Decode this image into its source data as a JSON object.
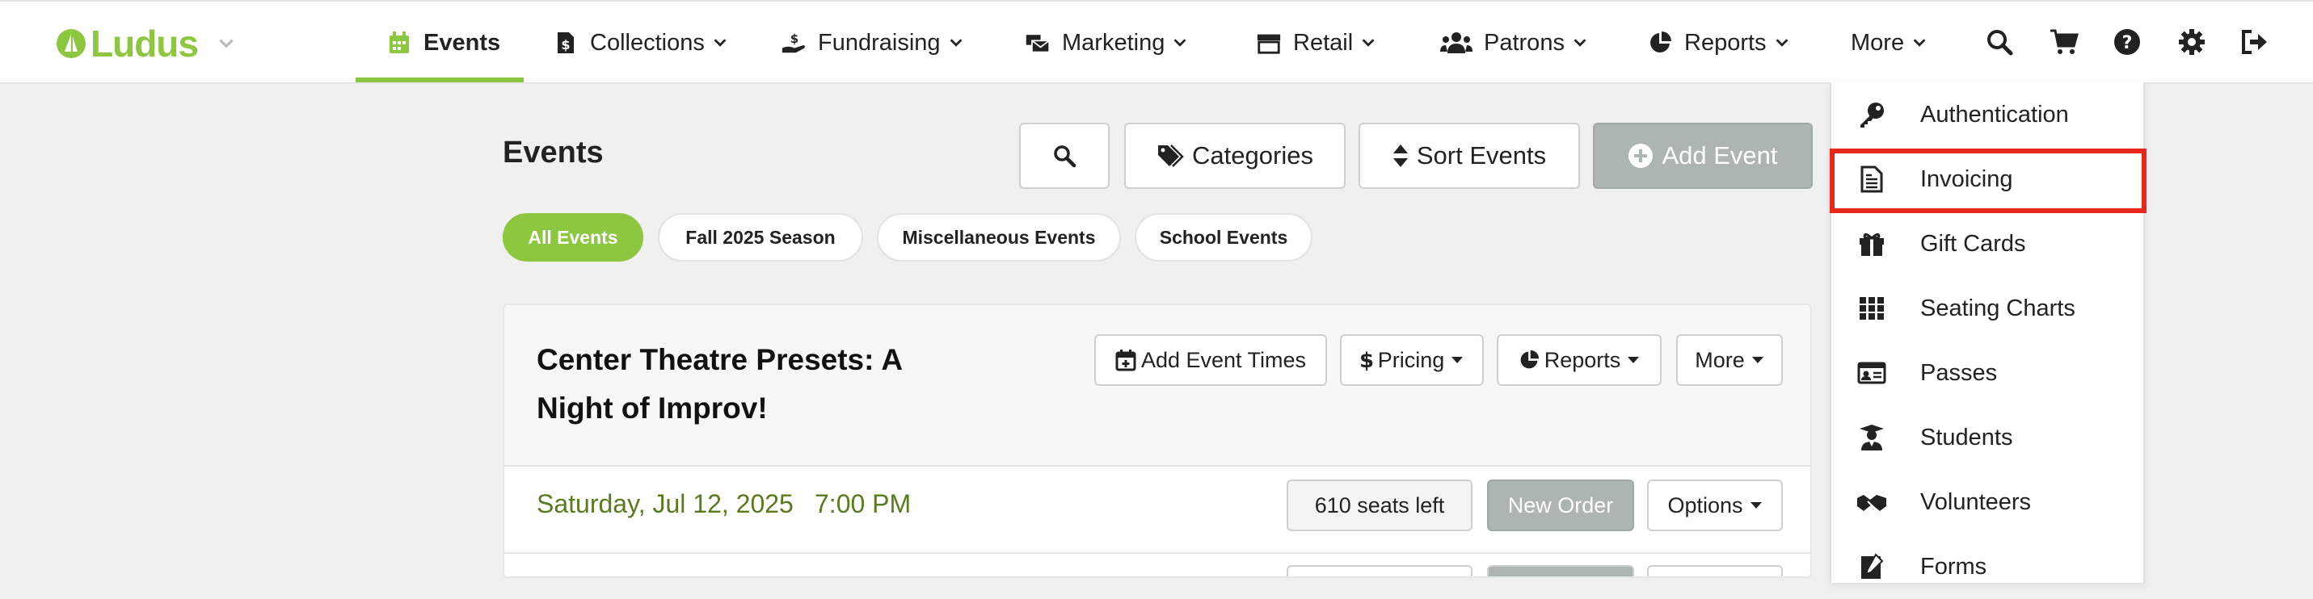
{
  "app": {
    "name": "Ludus"
  },
  "nav": {
    "items": [
      {
        "label": "Events",
        "icon": "calendar-icon"
      },
      {
        "label": "Collections",
        "icon": "dollar-file-icon"
      },
      {
        "label": "Fundraising",
        "icon": "hand-dollar-icon"
      },
      {
        "label": "Marketing",
        "icon": "mail-bulk-icon"
      },
      {
        "label": "Retail",
        "icon": "store-icon"
      },
      {
        "label": "Patrons",
        "icon": "users-icon"
      },
      {
        "label": "Reports",
        "icon": "pie-chart-icon"
      },
      {
        "label": "More",
        "icon": ""
      }
    ],
    "active": "Events",
    "right_icons": [
      "search-icon",
      "cart-icon",
      "help-icon",
      "gear-icon",
      "sign-out-icon"
    ]
  },
  "page": {
    "title": "Events",
    "toolbar": {
      "search_label": "",
      "categories_label": "Categories",
      "sort_label": "Sort Events",
      "add_label": "Add Event"
    },
    "filters": [
      "All Events",
      "Fall 2025 Season",
      "Miscellaneous Events",
      "School Events"
    ],
    "active_filter": "All Events"
  },
  "event": {
    "title": "Center Theatre Presets: A Night of Improv!",
    "buttons": {
      "add_times": "Add Event Times",
      "pricing": "Pricing",
      "reports": "Reports",
      "more": "More"
    },
    "performance": {
      "date": "Saturday, Jul 12, 2025",
      "time": "7:00 PM",
      "seats": "610 seats left",
      "new_order": "New Order",
      "options": "Options"
    }
  },
  "more_menu": {
    "items": [
      {
        "label": "Authentication",
        "icon": "key-icon"
      },
      {
        "label": "Invoicing",
        "icon": "invoice-icon"
      },
      {
        "label": "Gift Cards",
        "icon": "gift-icon"
      },
      {
        "label": "Seating Charts",
        "icon": "grid-icon"
      },
      {
        "label": "Passes",
        "icon": "id-card-icon"
      },
      {
        "label": "Students",
        "icon": "graduate-icon"
      },
      {
        "label": "Volunteers",
        "icon": "handshake-icon"
      },
      {
        "label": "Forms",
        "icon": "form-icon"
      }
    ],
    "highlighted": "Invoicing"
  },
  "colors": {
    "brand": "#8dc63f",
    "highlight": "#e8281b",
    "date_text": "#5a7a1e"
  }
}
